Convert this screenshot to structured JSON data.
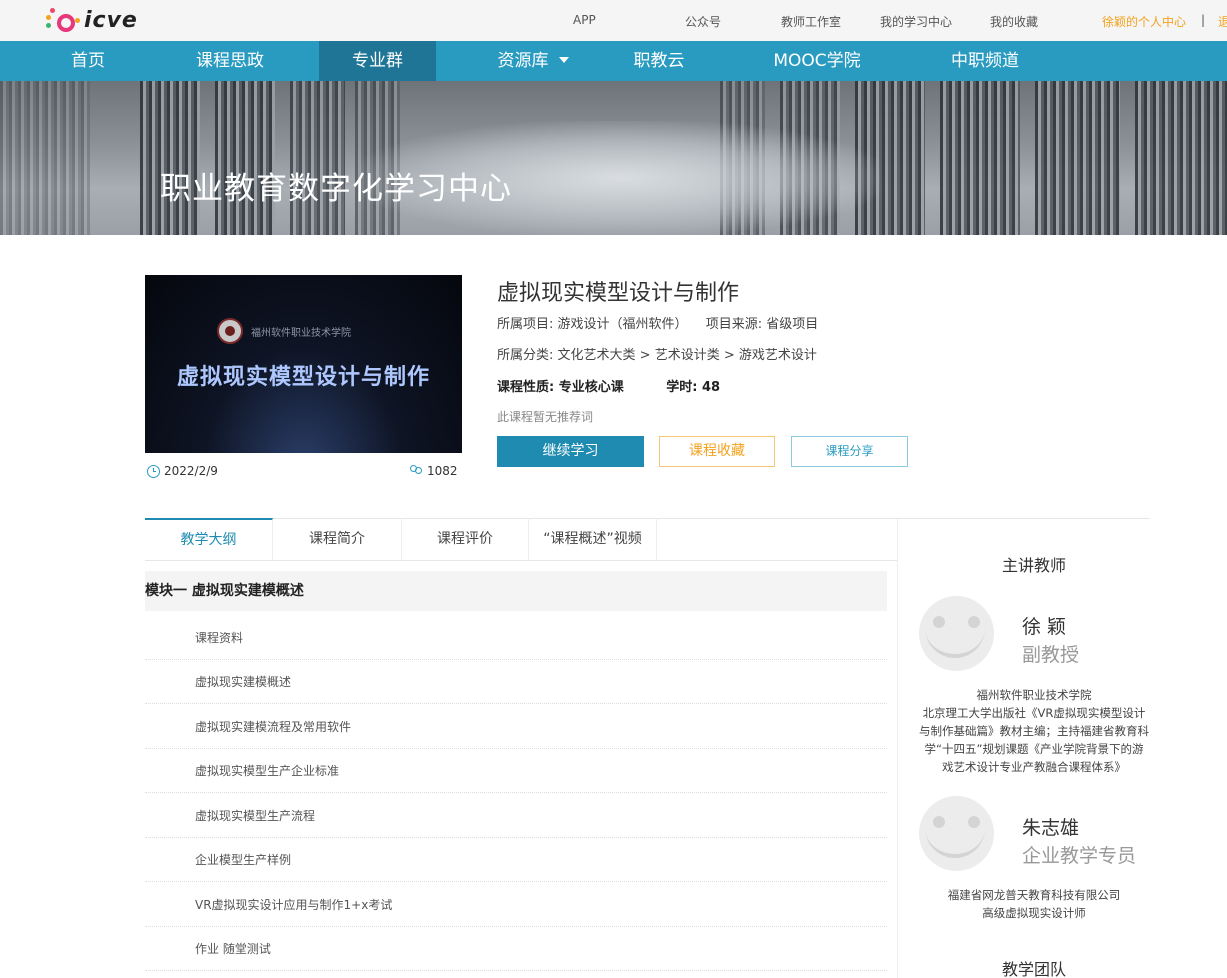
{
  "header": {
    "logo_text": "icve",
    "links": [
      {
        "label": "APP",
        "orange": false
      },
      {
        "label": "公众号",
        "orange": false
      },
      {
        "label": "教师工作室",
        "orange": false
      },
      {
        "label": "我的学习中心",
        "orange": false
      },
      {
        "label": "我的收藏",
        "orange": false
      },
      {
        "label": "徐颖的个人中心",
        "orange": true
      },
      {
        "label": "|",
        "orange": false
      },
      {
        "label": "退",
        "orange": true
      }
    ],
    "colors": {
      "nav": "#2a9bc0",
      "nav_active": "#1f7596",
      "accent_orange": "#f3a21d"
    }
  },
  "nav": {
    "items": [
      "首页",
      "课程思政",
      "专业群",
      "资源库",
      "职教云",
      "MOOC学院",
      "中职频道"
    ],
    "active_index": 2
  },
  "banner": {
    "title": "职业教育数字化学习中心"
  },
  "course": {
    "cover_school": "福州软件职业技术学院",
    "cover_title": "虚拟现实模型设计与制作",
    "date": "2022/2/9",
    "views": "1082",
    "title": "虚拟现实模型设计与制作",
    "project_label": "所属项目:",
    "project_value": "游戏设计（福州软件）",
    "source_label": "项目来源:",
    "source_value": "省级项目",
    "category_label": "所属分类:",
    "category_value": "文化艺术大类 > 艺术设计类 > 游戏艺术设计",
    "nature_label": "课程性质:",
    "nature_value": "专业核心课",
    "hours_label": "学时:",
    "hours_value": "48",
    "recommend": "此课程暂无推荐词",
    "buttons": {
      "continue": "继续学习",
      "favorite": "课程收藏",
      "share": "课程分享"
    }
  },
  "tabs": [
    "教学大纲",
    "课程简介",
    "课程评价",
    "“课程概述”视频"
  ],
  "syllabus": {
    "module_title": "模块一 虚拟现实建模概述",
    "lessons": [
      "课程资料",
      "虚拟现实建模概述",
      "虚拟现实建模流程及常用软件",
      "虚拟现实模型生产企业标准",
      "虚拟现实模型生产流程",
      "企业模型生产样例",
      "VR虚拟现实设计应用与制作1+x考试",
      " 作业  随堂测试"
    ]
  },
  "sidebar": {
    "teachers_heading": "主讲教师",
    "teachers": [
      {
        "name": "徐 颖",
        "role": "副教授",
        "desc": "福州软件职业技术学院\n北京理工大学出版社《VR虚拟现实模型设计与制作基础篇》教材主编；主持福建省教育科学“十四五”规划课题《产业学院背景下的游戏艺术设计专业产教融合课程体系》"
      },
      {
        "name": "朱志雄",
        "role": "企业教学专员",
        "desc": "福建省网龙普天教育科技有限公司\n高级虚拟现实设计师"
      }
    ],
    "team_heading": "教学团队"
  }
}
